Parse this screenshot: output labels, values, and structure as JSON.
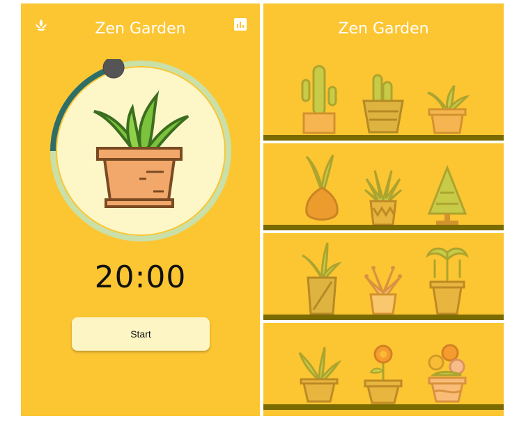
{
  "timer_screen": {
    "title": "Zen Garden",
    "left_icon": "lotus-icon",
    "right_icon": "stats-icon",
    "timer": "20:00",
    "start_label": "Start",
    "progress": 0.2
  },
  "garden_screen": {
    "title": "Zen Garden",
    "shelves": [
      [
        "cactus",
        "potted-cactus",
        "aloe-pot"
      ],
      [
        "snake-plant-vase",
        "agave-pot",
        "pine-tree"
      ],
      [
        "tall-grass-vase",
        "succulent-pot",
        "palm-pot"
      ],
      [
        "fern-pot",
        "flower-pot",
        "flowering-bush-pot"
      ]
    ]
  },
  "colors": {
    "background": "#fcc532",
    "ring_progress": "#2e6e66",
    "ring_track": "#c9e0a8",
    "circle_fill": "#fdf7c8",
    "shelf": "#7a6b00"
  }
}
